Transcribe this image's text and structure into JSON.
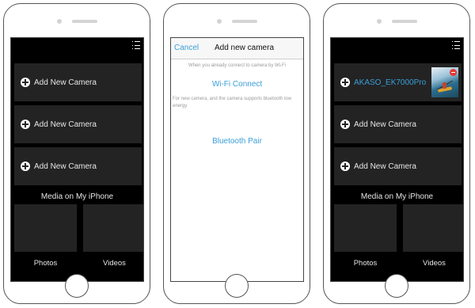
{
  "colors": {
    "accent": "#3a9fd9",
    "screen_dark": "#000000",
    "tile": "#232323",
    "hint_text": "#9a9a9a"
  },
  "left_screen": {
    "menu_icon": "list-menu-icon",
    "rows": [
      {
        "label": "Add New Camera",
        "icon": "plus-circle-icon"
      },
      {
        "label": "Add New Camera",
        "icon": "plus-circle-icon"
      },
      {
        "label": "Add New Camera",
        "icon": "plus-circle-icon"
      }
    ],
    "media_title": "Media on My iPhone",
    "photos_label": "Photos",
    "videos_label": "Videos"
  },
  "middle_screen": {
    "cancel_label": "Cancel",
    "title": "Add new camera",
    "hint_connected": "When you already connect to camera by Wi-Fi",
    "wifi_label": "Wi-Fi Connect",
    "hint_new": "For new camera, and the camera supports bluetooth low energy",
    "bluetooth_label": "Bluetooth Pair"
  },
  "right_screen": {
    "menu_icon": "list-menu-icon",
    "rows": [
      {
        "label": "AKASO_EK7000Pro",
        "icon": "plus-circle-icon",
        "connected": true
      },
      {
        "label": "Add New Camera",
        "icon": "plus-circle-icon"
      },
      {
        "label": "Add New Camera",
        "icon": "plus-circle-icon"
      }
    ],
    "media_title": "Media on My iPhone",
    "photos_label": "Photos",
    "videos_label": "Videos"
  }
}
